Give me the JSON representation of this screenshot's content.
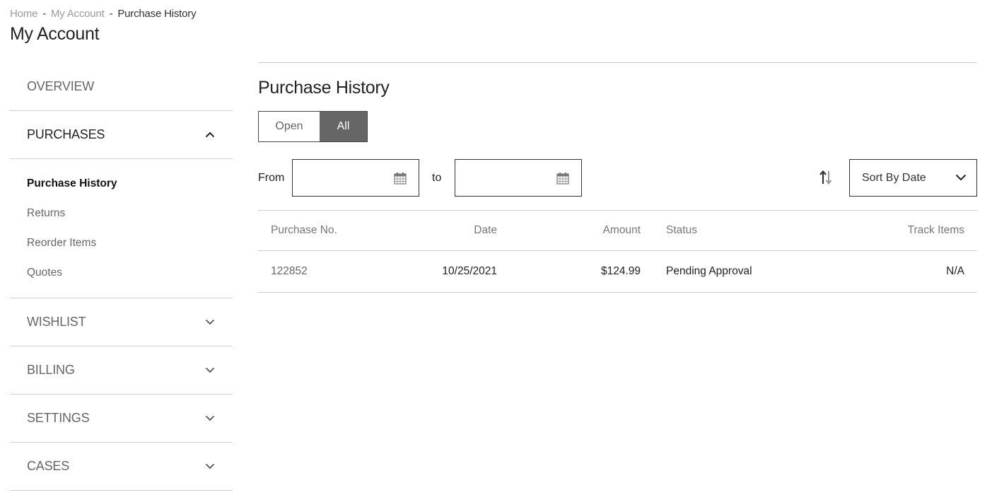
{
  "breadcrumb": {
    "items": [
      "Home",
      "My Account",
      "Purchase History"
    ],
    "separator": "-"
  },
  "page_title": "My Account",
  "sidebar": {
    "overview": "OVERVIEW",
    "purchases": {
      "label": "PURCHASES",
      "expanded": true,
      "items": [
        {
          "label": "Purchase History",
          "active": true
        },
        {
          "label": "Returns",
          "active": false
        },
        {
          "label": "Reorder Items",
          "active": false
        },
        {
          "label": "Quotes",
          "active": false
        }
      ]
    },
    "collapsed_sections": [
      "WISHLIST",
      "BILLING",
      "SETTINGS",
      "CASES"
    ]
  },
  "main": {
    "title": "Purchase History",
    "toggle": {
      "options": [
        "Open",
        "All"
      ],
      "selected": "All"
    },
    "filters": {
      "from_label": "From",
      "to_label": "to",
      "from_value": "",
      "to_value": "",
      "calendar_icon": "calendar-icon",
      "sort_icon": "sort-arrows-icon",
      "sort_selected": "Sort By Date"
    },
    "table": {
      "columns": [
        "Purchase No.",
        "Date",
        "Amount",
        "Status",
        "Track Items"
      ],
      "rows": [
        {
          "purchase_no": "122852",
          "date": "10/25/2021",
          "amount": "$124.99",
          "status": "Pending Approval",
          "track": "N/A"
        }
      ]
    }
  },
  "colors": {
    "toggle_active_bg": "#666666",
    "divider": "#cfcfcf",
    "muted_text": "#666666"
  }
}
